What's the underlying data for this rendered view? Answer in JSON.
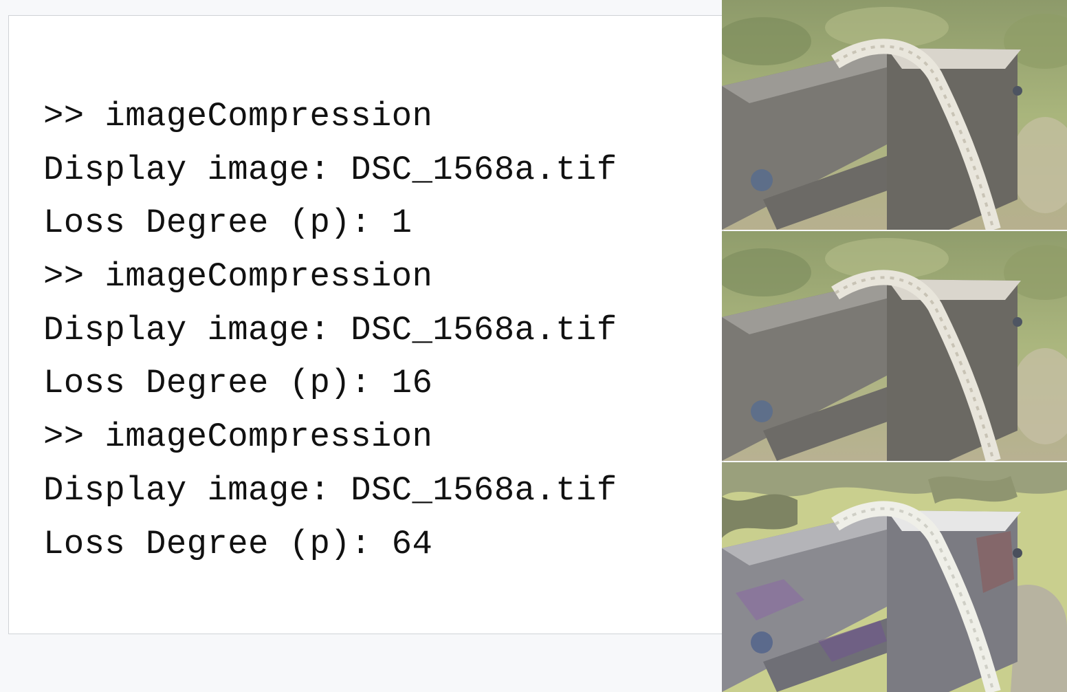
{
  "console": {
    "lines": [
      ">> imageCompression",
      "Display image: DSC_1568a.tif",
      "Loss Degree (p): 1",
      ">> imageCompression",
      "Display image: DSC_1568a.tif",
      "Loss Degree (p): 16",
      ">> imageCompression",
      "Display image: DSC_1568a.tif",
      "Loss Degree (p): 64"
    ]
  },
  "photos": [
    {
      "loss_degree": 1
    },
    {
      "loss_degree": 16
    },
    {
      "loss_degree": 64
    }
  ],
  "colors": {
    "console_background": "#ffffff",
    "console_border": "#cfd2d6",
    "page_background": "#f7f8fa",
    "text": "#111111",
    "grass": "#9cab6e",
    "wood": "#7d7a73",
    "rope": "#e9e6dc"
  }
}
